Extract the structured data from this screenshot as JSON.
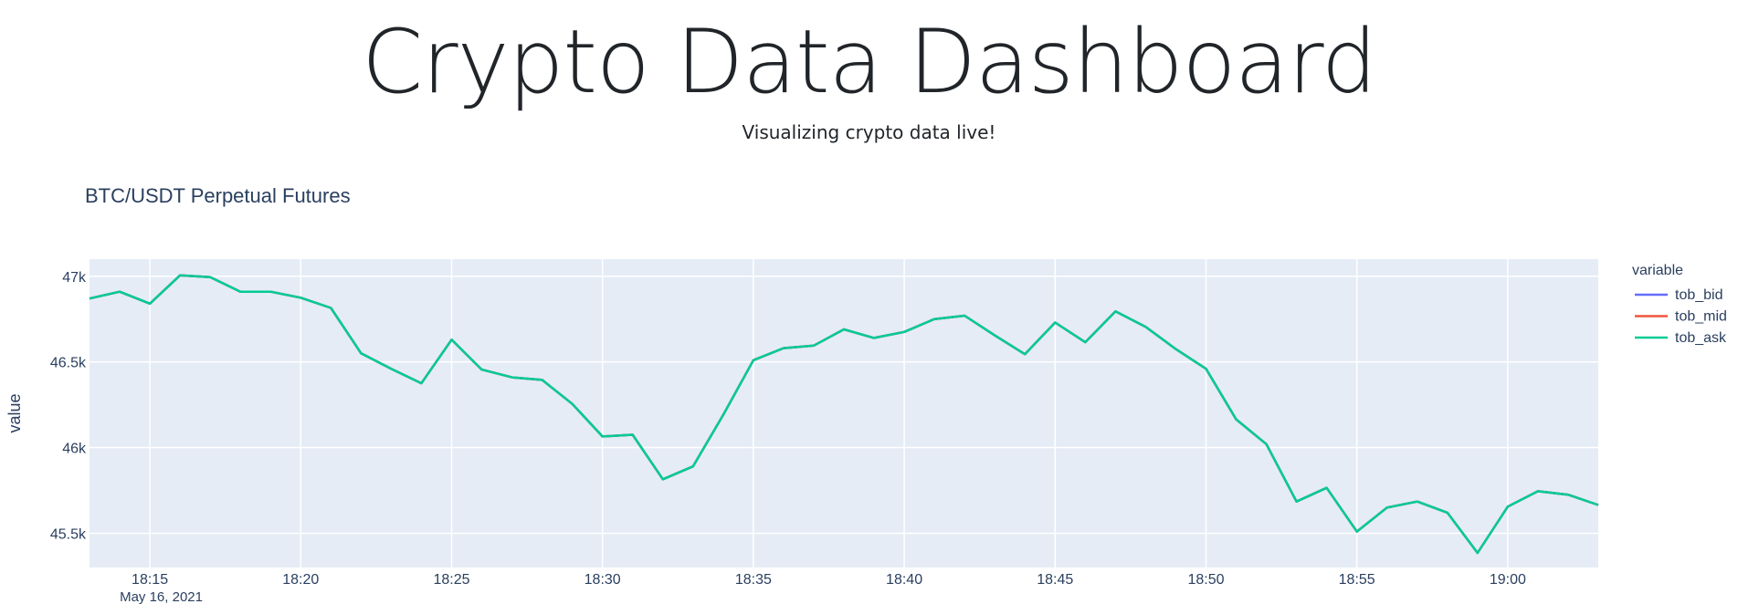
{
  "header": {
    "title": "Crypto Data Dashboard",
    "subtitle": "Visualizing crypto data live!"
  },
  "chart_data": {
    "type": "line",
    "title": "BTC/USDT Perpetual Futures",
    "xlabel": "",
    "ylabel": "value",
    "x_date": "May 16, 2021",
    "x_start": "18:13",
    "x_range_minutes": [
      0,
      50
    ],
    "x_tick_labels": [
      "18:15",
      "18:20",
      "18:25",
      "18:30",
      "18:35",
      "18:40",
      "18:45",
      "18:50",
      "18:55",
      "19:00"
    ],
    "x_tick_minutes": [
      2,
      7,
      12,
      17,
      22,
      27,
      32,
      37,
      42,
      47
    ],
    "ylim": [
      45300,
      47100
    ],
    "y_ticks": [
      45500,
      46000,
      46500,
      47000
    ],
    "y_tick_labels": [
      "45.5k",
      "46k",
      "46.5k",
      "47k"
    ],
    "grid": true,
    "plot_bgcolor": "#e5ecf6",
    "legend": {
      "title": "variable",
      "position": "right"
    },
    "times": [
      "18:13",
      "18:14",
      "18:15",
      "18:16",
      "18:17",
      "18:18",
      "18:19",
      "18:20",
      "18:21",
      "18:22",
      "18:23",
      "18:24",
      "18:25",
      "18:26",
      "18:27",
      "18:28",
      "18:29",
      "18:30",
      "18:31",
      "18:32",
      "18:33",
      "18:34",
      "18:35",
      "18:36",
      "18:37",
      "18:38",
      "18:39",
      "18:40",
      "18:41",
      "18:42",
      "18:43",
      "18:44",
      "18:45",
      "18:46",
      "18:47",
      "18:48",
      "18:49",
      "18:50",
      "18:51",
      "18:52",
      "18:53",
      "18:54",
      "18:55",
      "18:56",
      "18:57",
      "18:58",
      "18:59",
      "19:00",
      "19:01",
      "19:02",
      "19:03"
    ],
    "series": [
      {
        "name": "tob_bid",
        "color": "#636efa",
        "values": [
          46870,
          46910,
          46840,
          47005,
          46995,
          46910,
          46910,
          46875,
          46815,
          46550,
          46460,
          46375,
          46630,
          46455,
          46410,
          46395,
          46255,
          46065,
          46075,
          45815,
          45890,
          46190,
          46510,
          46580,
          46595,
          46690,
          46640,
          46675,
          46750,
          46770,
          46655,
          46545,
          46730,
          46615,
          46795,
          46705,
          46575,
          46460,
          46165,
          46020,
          45685,
          45765,
          45510,
          45650,
          45685,
          45620,
          45385,
          45655,
          45745,
          45725,
          45665
        ]
      },
      {
        "name": "tob_mid",
        "color": "#ef553b",
        "values": [
          46870,
          46910,
          46840,
          47005,
          46995,
          46910,
          46910,
          46875,
          46815,
          46550,
          46460,
          46375,
          46630,
          46455,
          46410,
          46395,
          46255,
          46065,
          46075,
          45815,
          45890,
          46190,
          46510,
          46580,
          46595,
          46690,
          46640,
          46675,
          46750,
          46770,
          46655,
          46545,
          46730,
          46615,
          46795,
          46705,
          46575,
          46460,
          46165,
          46020,
          45685,
          45765,
          45510,
          45650,
          45685,
          45620,
          45385,
          45655,
          45745,
          45725,
          45665
        ]
      },
      {
        "name": "tob_ask",
        "color": "#00cc96",
        "values": [
          46870,
          46910,
          46840,
          47005,
          46995,
          46910,
          46910,
          46875,
          46815,
          46550,
          46460,
          46375,
          46630,
          46455,
          46410,
          46395,
          46255,
          46065,
          46075,
          45815,
          45890,
          46190,
          46510,
          46580,
          46595,
          46690,
          46640,
          46675,
          46750,
          46770,
          46655,
          46545,
          46730,
          46615,
          46795,
          46705,
          46575,
          46460,
          46165,
          46020,
          45685,
          45765,
          45510,
          45650,
          45685,
          45620,
          45385,
          45655,
          45745,
          45725,
          45665
        ]
      }
    ]
  }
}
